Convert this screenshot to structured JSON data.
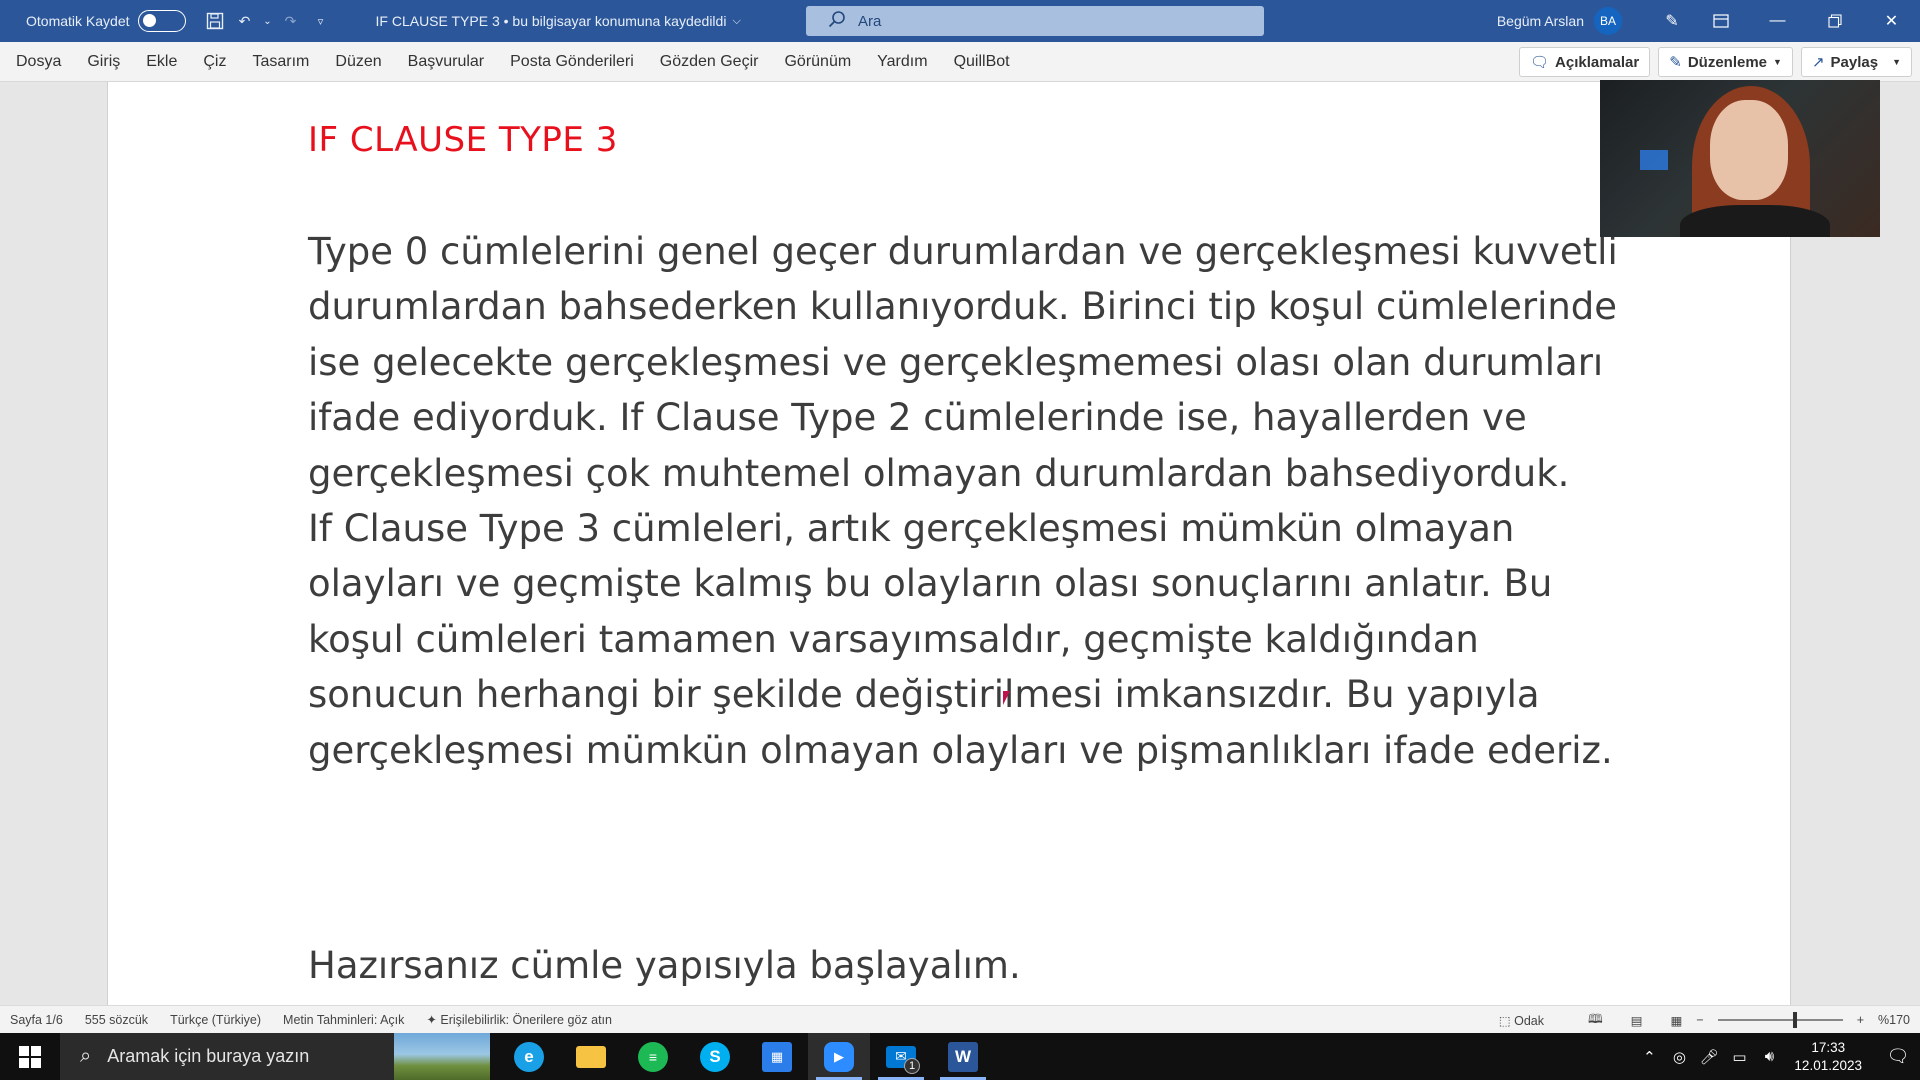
{
  "titlebar": {
    "autosave_label": "Otomatik Kaydet",
    "doc_title": "IF CLAUSE TYPE 3 • bu bilgisayar konumuna kaydedildi",
    "search_placeholder": "Ara",
    "user_name": "Begüm Arslan",
    "user_initials": "BA"
  },
  "menubar": {
    "items": [
      "Dosya",
      "Giriş",
      "Ekle",
      "Çiz",
      "Tasarım",
      "Düzen",
      "Başvurular",
      "Posta Gönderileri",
      "Gözden Geçir",
      "Görünüm",
      "Yardım",
      "QuillBot"
    ],
    "comments_label": "Açıklamalar",
    "editing_label": "Düzenleme",
    "share_label": "Paylaş"
  },
  "document": {
    "heading": "IF CLAUSE TYPE 3",
    "paragraph1": "Type 0 cümlelerini genel geçer durumlardan ve gerçekleşmesi kuvvetli durumlardan bahsederken kullanıyorduk. Birinci tip koşul cümlelerinde ise gelecekte gerçekleşmesi ve gerçekleşmemesi olası olan durumları ifade ediyorduk. If Clause Type 2 cümlelerinde ise, hayallerden ve gerçekleşmesi çok muhtemel olmayan durumlardan bahsediyorduk.",
    "paragraph2": "If Clause Type 3 cümleleri, artık gerçekleşmesi mümkün olmayan olayları ve geçmişte kalmış bu olayların olası sonuçlarını anlatır. Bu koşul cümleleri tamamen varsayımsaldır, geçmişte kaldığından sonucun herhangi bir şekilde değiştirilmesi imkansızdır. Bu yapıyla gerçekleşmesi mümkün olmayan olayları ve pişmanlıkları ifade ederiz.",
    "paragraph3": "Hazırsanız cümle yapısıyla başlayalım."
  },
  "statusbar": {
    "page": "Sayfa 1/6",
    "words": "555 sözcük",
    "language": "Türkçe (Türkiye)",
    "predictions": "Metin Tahminleri: Açık",
    "accessibility": "Erişilebilirlik: Önerilere göz atın",
    "focus": "Odak",
    "zoom": "%170",
    "zoom_level": 0.6
  },
  "taskbar": {
    "search_placeholder": "Aramak için buraya yazın",
    "apps": [
      {
        "name": "edge",
        "icon": "edge-icon",
        "color": "#1aa0e6"
      },
      {
        "name": "file-explorer",
        "icon": "folder-icon",
        "color": "#f6c343"
      },
      {
        "name": "spotify",
        "icon": "spotify-icon",
        "color": "#1db954"
      },
      {
        "name": "skype",
        "icon": "skype-icon",
        "color": "#00aff0"
      },
      {
        "name": "store",
        "icon": "store-icon",
        "color": "#2b7de9"
      },
      {
        "name": "zoom",
        "icon": "zoom-icon",
        "color": "#2d8cff"
      },
      {
        "name": "mail",
        "icon": "mail-icon",
        "color": "#0078d4"
      },
      {
        "name": "word",
        "icon": "word-icon",
        "color": "#2b579a"
      }
    ],
    "mail_badge": "1",
    "time": "17:33",
    "date": "12.01.2023"
  },
  "colors": {
    "word_blue": "#2b579a",
    "heading_red": "#e8101d"
  }
}
